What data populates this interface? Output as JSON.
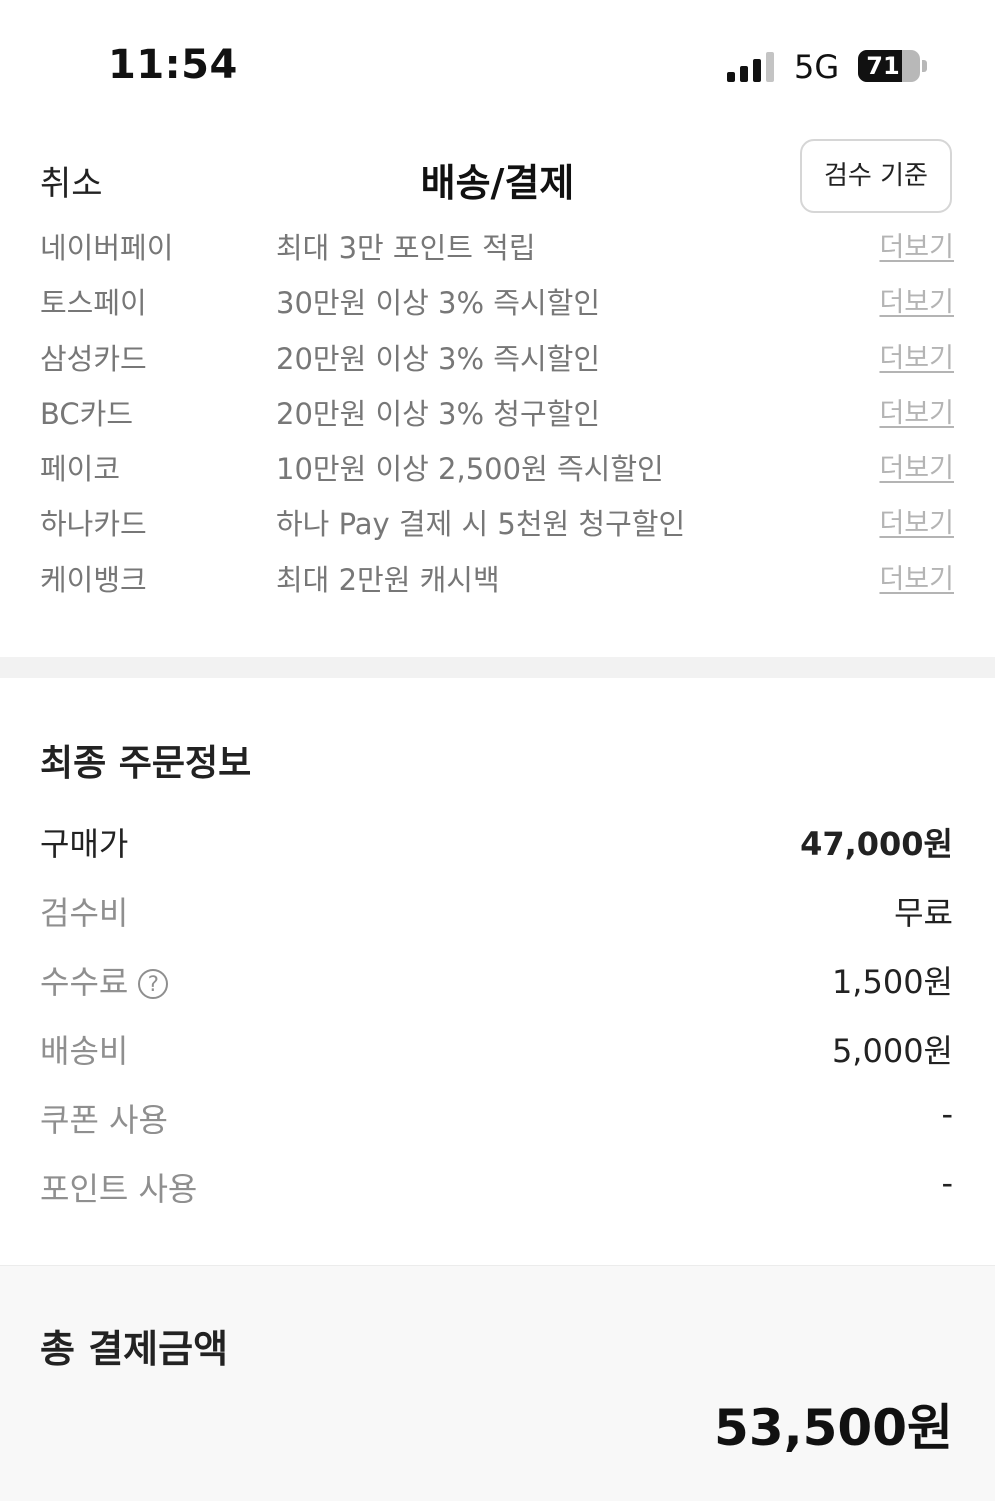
{
  "status_bar": {
    "time": "11:54",
    "network": "5G",
    "battery": "71",
    "battery_level": 0.71
  },
  "header": {
    "cancel_label": "취소",
    "title": "배송/결제",
    "inspect_label": "검수 기준"
  },
  "promotions": [
    {
      "name": "네이버페이",
      "description": "최대 3만 포인트 적립",
      "more": "더보기"
    },
    {
      "name": "토스페이",
      "description": "30만원 이상 3% 즉시할인",
      "more": "더보기"
    },
    {
      "name": "삼성카드",
      "description": "20만원 이상 3% 즉시할인",
      "more": "더보기"
    },
    {
      "name": "BC카드",
      "description": "20만원 이상 3% 청구할인",
      "more": "더보기"
    },
    {
      "name": "페이코",
      "description": "10만원 이상 2,500원 즉시할인",
      "more": "더보기"
    },
    {
      "name": "하나카드",
      "description": "하나 Pay 결제 시 5천원 청구할인",
      "more": "더보기"
    },
    {
      "name": "케이뱅크",
      "description": "최대 2만원 캐시백",
      "more": "더보기"
    }
  ],
  "order_info": {
    "title": "최종 주문정보",
    "rows": [
      {
        "label": "구매가",
        "value": "47,000원"
      },
      {
        "label": "검수비",
        "value": "무료"
      },
      {
        "label": "수수료",
        "value": "1,500원",
        "help_icon": "?"
      },
      {
        "label": "배송비",
        "value": "5,000원"
      },
      {
        "label": "쿠폰 사용",
        "value": "-"
      },
      {
        "label": "포인트 사용",
        "value": "-"
      }
    ]
  },
  "total": {
    "label": "총 결제금액",
    "amount": "53,500원"
  },
  "icons": {
    "signal": "cellular-signal-icon",
    "battery": "battery-icon",
    "help": "question-circle-icon"
  },
  "colors": {
    "text_primary": "#222222",
    "text_secondary": "#777777",
    "text_muted": "#8f8f8f",
    "link": "#b4b4b4",
    "divider": "#f2f2f2",
    "total_background": "#f8f8f8"
  }
}
